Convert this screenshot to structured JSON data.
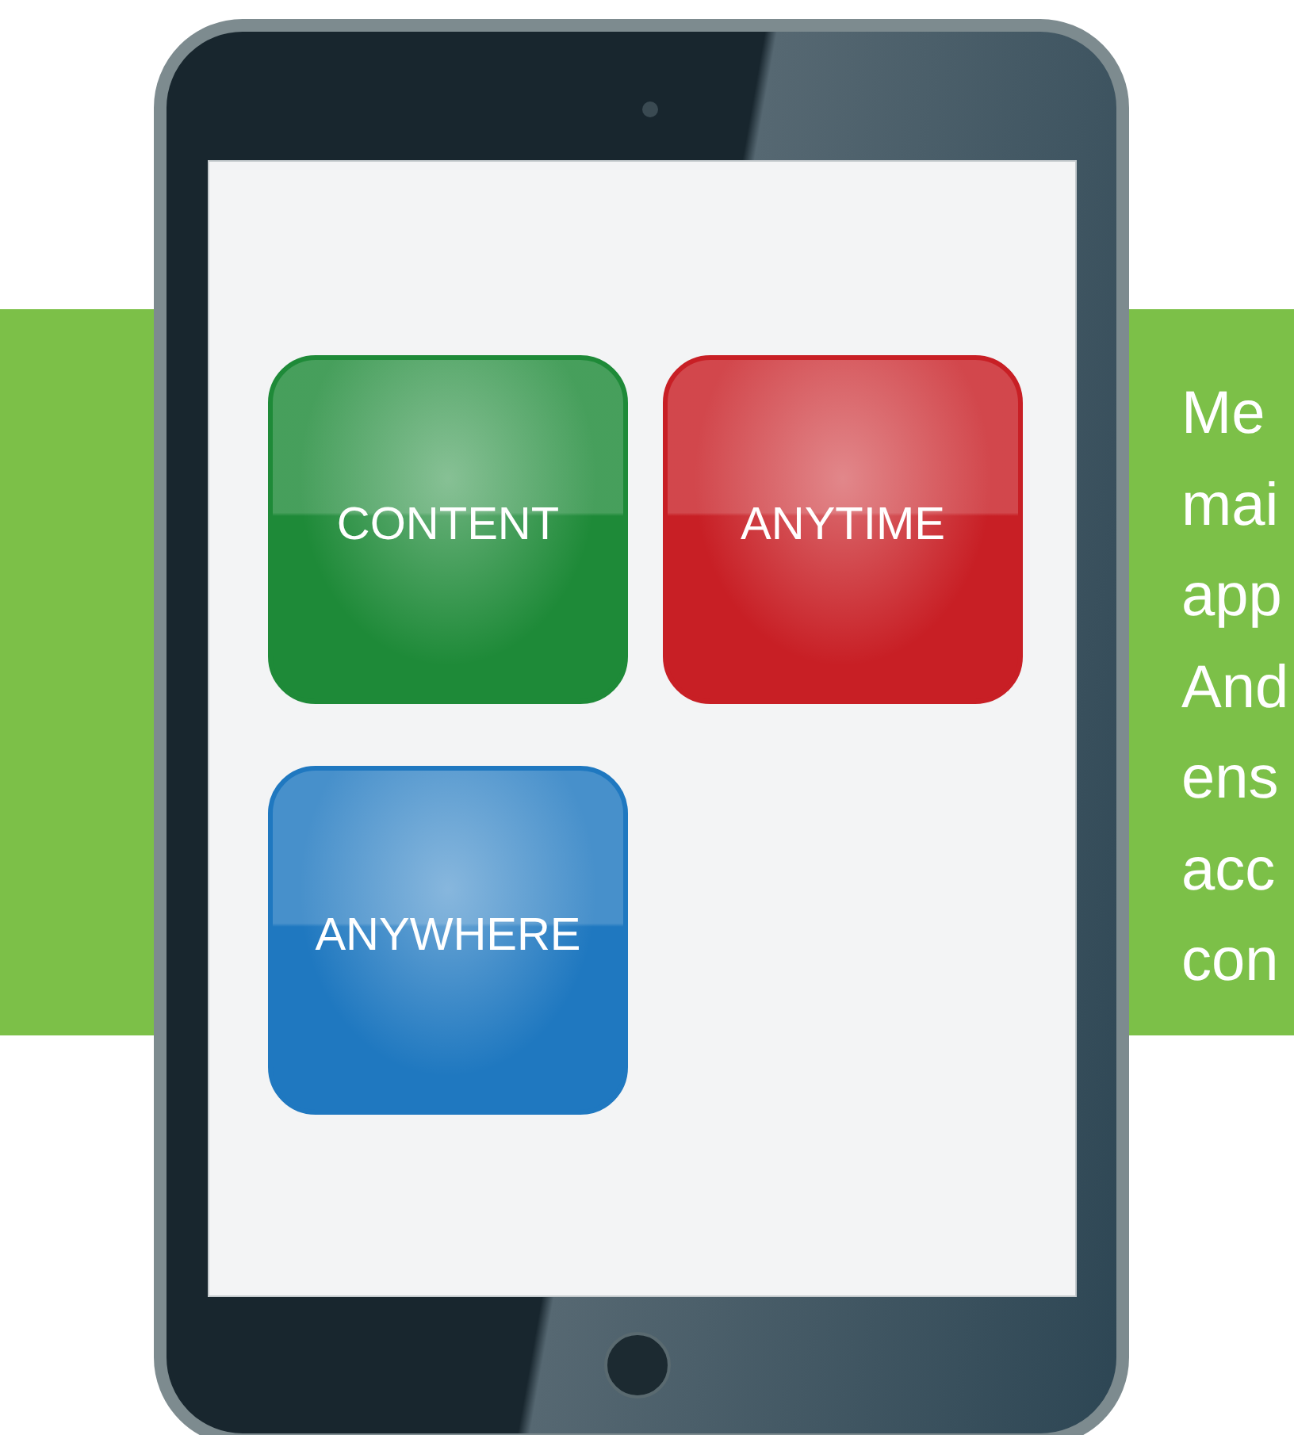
{
  "screen": {
    "tiles": [
      {
        "label": "CONTENT",
        "color": "#1e8a38"
      },
      {
        "label": "ANYTIME",
        "color": "#c81f25"
      },
      {
        "label": "ANYWHERE",
        "color": "#1f78c0"
      }
    ]
  },
  "side_text": {
    "lines": [
      "Me",
      "mai",
      "app",
      "And",
      "ens",
      "acc",
      "con"
    ]
  }
}
